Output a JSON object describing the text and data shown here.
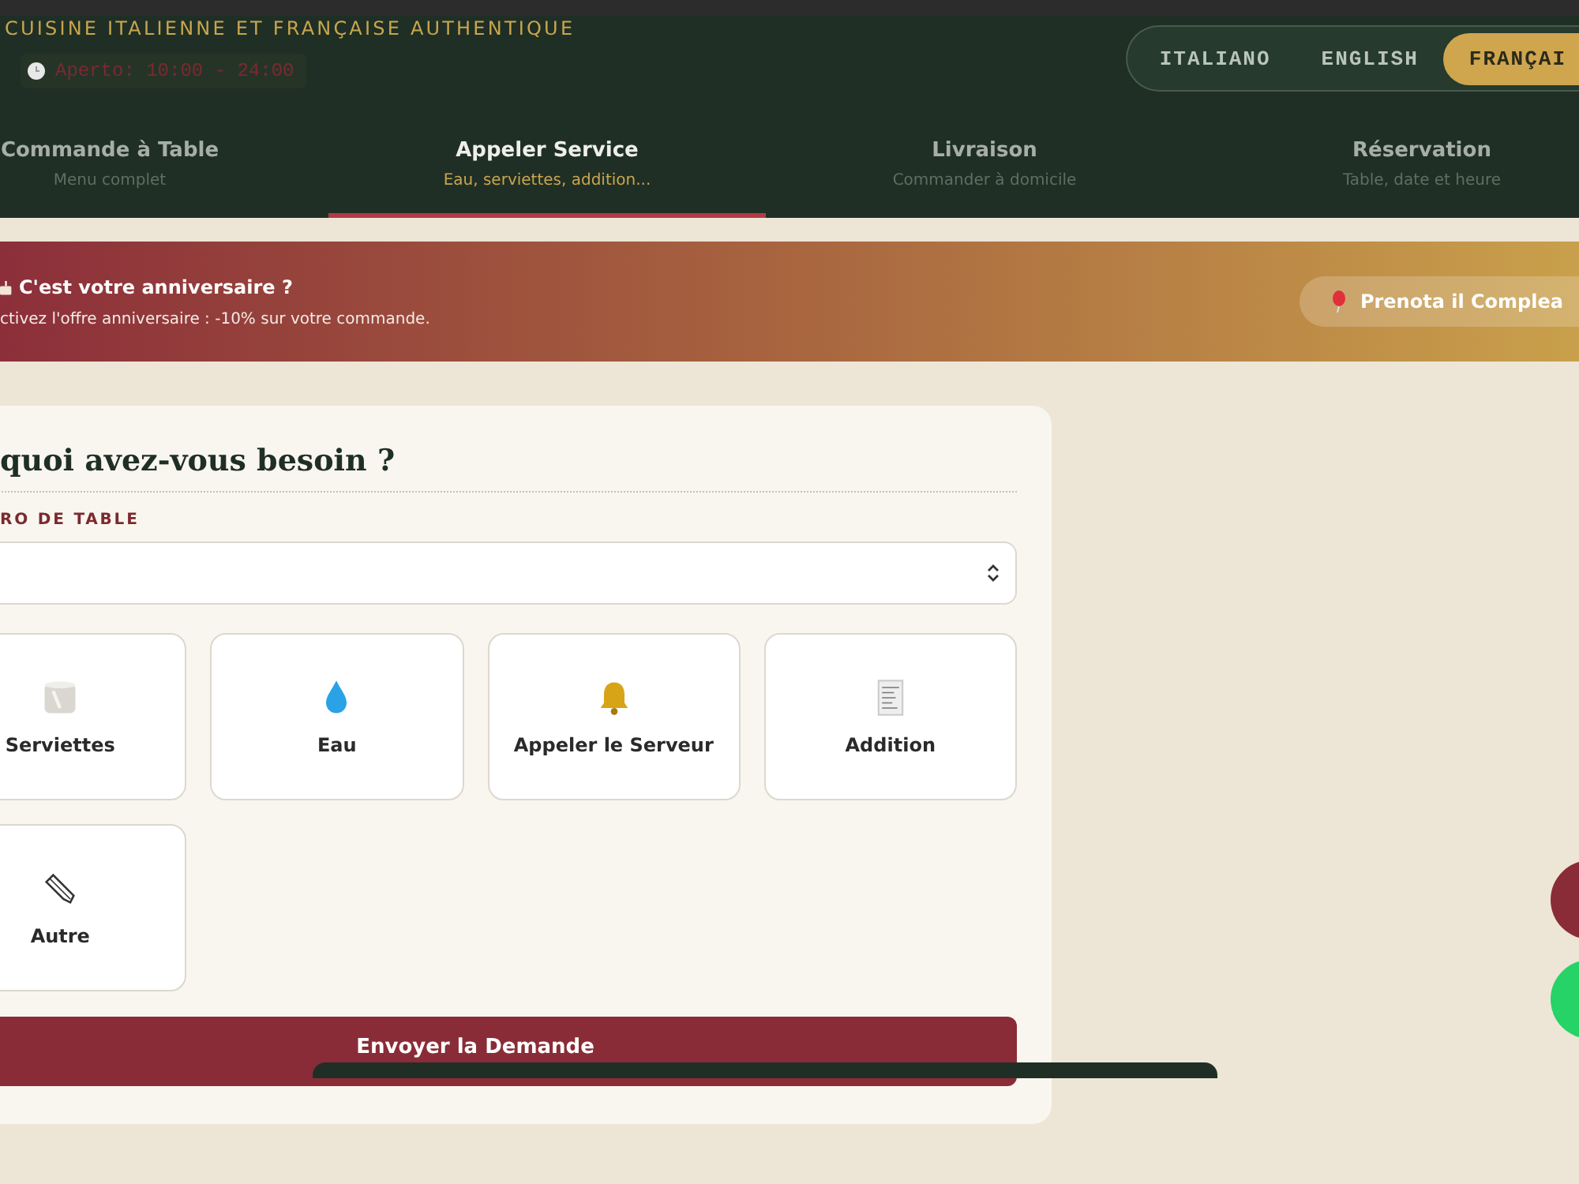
{
  "header": {
    "tagline": "CUISINE ITALIENNE ET FRANÇAISE AUTHENTIQUE",
    "hours": "Aperto: 10:00 - 24:00",
    "languages": [
      {
        "label": "ITALIANO",
        "selected": false
      },
      {
        "label": "ENGLISH",
        "selected": false
      },
      {
        "label": "FRANÇAI",
        "selected": true
      }
    ]
  },
  "tabs": [
    {
      "label": "Commande à Table",
      "sub": "Menu complet",
      "selected": false
    },
    {
      "label": "Appeler Service",
      "sub": "Eau, serviettes, addition...",
      "selected": true
    },
    {
      "label": "Livraison",
      "sub": "Commander à domicile",
      "selected": false
    },
    {
      "label": "Réservation",
      "sub": "Table, date et heure",
      "selected": false
    }
  ],
  "banner": {
    "title": "C'est votre anniversaire ?",
    "text": "ctivez l'offre anniversaire : -10% sur votre commande.",
    "button": "Prenota il Complea"
  },
  "form": {
    "title": "quoi avez-vous besoin ?",
    "field_label": "RO DE TABLE",
    "services": [
      {
        "kind": "napkins",
        "label": "Serviettes"
      },
      {
        "kind": "water",
        "label": "Eau"
      },
      {
        "kind": "bell",
        "label": "Appeler le Serveur"
      },
      {
        "kind": "bill",
        "label": "Addition"
      },
      {
        "kind": "other",
        "label": "Autre"
      }
    ],
    "submit": "Envoyer la Demande"
  }
}
